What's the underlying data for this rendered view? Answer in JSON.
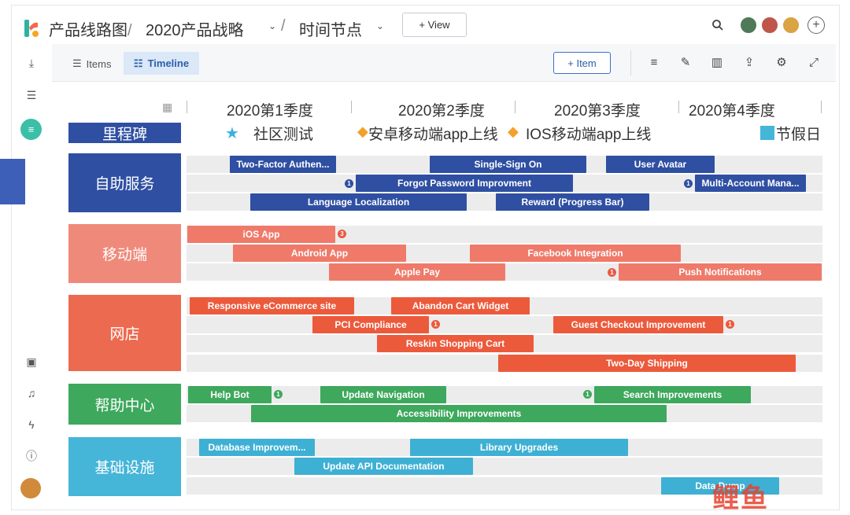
{
  "topbar": {
    "breadcrumb": [
      "产品线路图",
      "2020产品战略",
      "时间节点"
    ],
    "view_button": "+ View"
  },
  "toolbar": {
    "tab_items": "Items",
    "tab_timeline": "Timeline",
    "add_item_button": "+ Item"
  },
  "timeline": {
    "quarters": [
      "2020第1季度",
      "2020第2季度",
      "2020第3季度",
      "2020第4季度"
    ],
    "milestones": {
      "label": "里程碑",
      "items": [
        "社区测试",
        "安卓移动端app上线",
        "IOS移动端app上线"
      ],
      "holiday": "节假日"
    },
    "groups": [
      {
        "name": "自助服务",
        "color": "#2f4fa2",
        "bars": [
          {
            "label": "Two-Factor Authen...",
            "badge": ""
          },
          {
            "label": "Single-Sign On",
            "badge": ""
          },
          {
            "label": "User Avatar",
            "badge": ""
          },
          {
            "label": "Forgot Password Improvment",
            "badge": "1"
          },
          {
            "label": "Multi-Account Mana...",
            "badge": "1"
          },
          {
            "label": "Language Localization",
            "badge": ""
          },
          {
            "label": "Reward (Progress Bar)",
            "badge": ""
          }
        ]
      },
      {
        "name": "移动端",
        "color": "#ef8a7b",
        "bars": [
          {
            "label": "iOS App",
            "badge": "3"
          },
          {
            "label": "Android App",
            "badge": ""
          },
          {
            "label": "Facebook Integration",
            "badge": ""
          },
          {
            "label": "Apple Pay",
            "badge": ""
          },
          {
            "label": "Push Notifications",
            "badge": "1"
          }
        ]
      },
      {
        "name": "网店",
        "color": "#ec6a4f",
        "bars": [
          {
            "label": "Responsive eCommerce site",
            "badge": ""
          },
          {
            "label": "Abandon Cart Widget",
            "badge": ""
          },
          {
            "label": "PCI Compliance",
            "badge": "1"
          },
          {
            "label": "Guest Checkout Improvement",
            "badge": "1"
          },
          {
            "label": "Reskin Shopping Cart",
            "badge": ""
          },
          {
            "label": "Two-Day Shipping",
            "badge": ""
          }
        ]
      },
      {
        "name": "帮助中心",
        "color": "#3ea85d",
        "bars": [
          {
            "label": "Help Bot",
            "badge": "1"
          },
          {
            "label": "Update Navigation",
            "badge": ""
          },
          {
            "label": "Search Improvements",
            "badge": "1"
          },
          {
            "label": "Accessibility Improvements",
            "badge": ""
          }
        ]
      },
      {
        "name": "基础设施",
        "color": "#45b5d8",
        "bars": [
          {
            "label": "Database Improvem...",
            "badge": ""
          },
          {
            "label": "Library Upgrades",
            "badge": ""
          },
          {
            "label": "Update API Documentation",
            "badge": ""
          },
          {
            "label": "Data Dump",
            "badge": ""
          }
        ]
      }
    ]
  },
  "watermark": "鲤鱼",
  "icons": [
    "logo-icon",
    "search-icon",
    "download-icon",
    "list-icon",
    "roadmap-icon",
    "filter-icon",
    "edit-icon",
    "columns-icon",
    "share-icon",
    "gear-icon",
    "fullscreen-icon",
    "calendar-icon",
    "star-icon",
    "diamond-icon",
    "contacts-icon",
    "bell-icon",
    "bolt-icon",
    "help-icon"
  ]
}
